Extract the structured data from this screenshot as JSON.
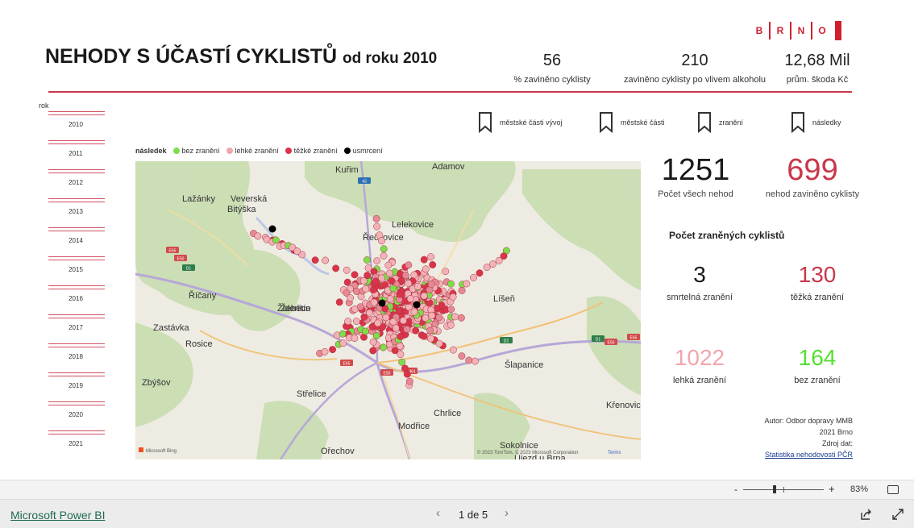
{
  "logo": {
    "letters": [
      "B",
      "R",
      "N",
      "O"
    ]
  },
  "header": {
    "title_main": "NEHODY S ÚČASTÍ CYKLISTŮ",
    "title_sub": "od roku 2010",
    "kpis": [
      {
        "value": "56",
        "label": "% zaviněno cyklisty"
      },
      {
        "value": "210",
        "label": "zaviněno cyklisty po vlivem alkoholu"
      },
      {
        "value": "12,68 Mil",
        "label": "prům. škoda Kč"
      }
    ]
  },
  "year_slicer": {
    "label": "rok",
    "years": [
      "2010",
      "2011",
      "2012",
      "2013",
      "2014",
      "2015",
      "2016",
      "2017",
      "2018",
      "2019",
      "2020",
      "2021"
    ]
  },
  "bookmarks": [
    {
      "label": "městské části vývoj"
    },
    {
      "label": "městské části"
    },
    {
      "label": "zranění"
    },
    {
      "label": "následky"
    }
  ],
  "legend": {
    "title": "následek",
    "items": [
      {
        "label": "bez zranění",
        "color": "#7ddd4a"
      },
      {
        "label": "lehké zranění",
        "color": "#f0a6ad"
      },
      {
        "label": "těžké zranění",
        "color": "#d9344a"
      },
      {
        "label": "usmrcení",
        "color": "#000000"
      }
    ]
  },
  "map": {
    "places": [
      "Kuřim",
      "Adamov",
      "Lažánky",
      "Veverská Bitýška",
      "Řečkovice",
      "Lelekovice",
      "Králové Pole",
      "Židenice",
      "Říčany",
      "Žebětín",
      "Zastávka",
      "Rosice",
      "Líšeň",
      "Šlapanice",
      "Zbýšov",
      "Střelice",
      "Modřice",
      "Chrlice",
      "Křenovice",
      "Ořechov",
      "Sokolnice",
      "Újezd u Brna"
    ],
    "road_labels": [
      "43",
      "E65",
      "E50",
      "D1",
      "E50",
      "E461",
      "E65",
      "E50",
      "D1",
      "D2",
      "E65"
    ],
    "attribution_left": "Microsoft Bing",
    "attribution_right": "© 2023 TomTom, © 2023 Microsoft Corporation",
    "terms": "Terms"
  },
  "totals": {
    "all": {
      "value": "1251",
      "label": "Počet všech nehod"
    },
    "cyclist_fault": {
      "value": "699",
      "label": "nehod zaviněno cyklisty"
    }
  },
  "injuries": {
    "heading": "Počet zraněných cyklistů",
    "fatal": {
      "value": "3",
      "label": "smrtelná zranění"
    },
    "severe": {
      "value": "130",
      "label": "těžká zranění"
    },
    "light": {
      "value": "1022",
      "label": "lehká zranění"
    },
    "none": {
      "value": "164",
      "label": "bez zranění"
    }
  },
  "credits": {
    "line1": "Autor: Odbor dopravy MMB",
    "line2": "2021 Brno",
    "line3": "Zdroj dat:",
    "link": "Statistika nehodovosti PČR"
  },
  "zoom": {
    "minus": "-",
    "plus": "+",
    "level": "83%"
  },
  "footer": {
    "brand": "Microsoft Power BI",
    "page": "1 de 5",
    "prev": "‹",
    "next": "›"
  },
  "colors": {
    "accent": "#d0202e",
    "severe": "#c8384a",
    "light": "#f0a6ad",
    "none": "#55e030",
    "fatal": "#1a1a1a"
  }
}
